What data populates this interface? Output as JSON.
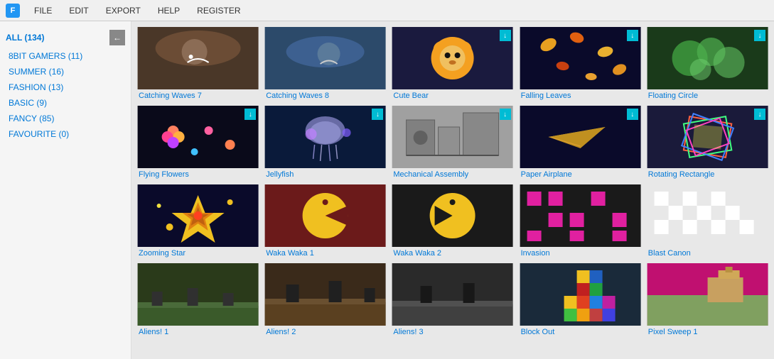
{
  "app": {
    "logo": "F",
    "menu": [
      "FILE",
      "EDIT",
      "EXPORT",
      "HELP",
      "REGISTER"
    ]
  },
  "sidebar": {
    "items": [
      {
        "label": "ALL (134)",
        "active": true
      },
      {
        "label": "8BIT GAMERS (11)",
        "active": false
      },
      {
        "label": "SUMMER (16)",
        "active": false
      },
      {
        "label": "FASHION (13)",
        "active": false
      },
      {
        "label": "BASIC (9)",
        "active": false
      },
      {
        "label": "FANCY (85)",
        "active": false
      },
      {
        "label": "FAVOURITE (0)",
        "active": false
      }
    ]
  },
  "gallery": {
    "items": [
      {
        "id": "catching7",
        "label": "Catching Waves 7",
        "has_download": false
      },
      {
        "id": "catching8",
        "label": "Catching Waves 8",
        "has_download": false
      },
      {
        "id": "cutebear",
        "label": "Cute Bear",
        "has_download": true
      },
      {
        "id": "fallingleaves",
        "label": "Falling Leaves",
        "has_download": true
      },
      {
        "id": "floatingcircle",
        "label": "Floating Circle",
        "has_download": true
      },
      {
        "id": "flyingflowers",
        "label": "Flying Flowers",
        "has_download": true
      },
      {
        "id": "jellyfish",
        "label": "Jellyfish",
        "has_download": true
      },
      {
        "id": "mechanical",
        "label": "Mechanical Assembly",
        "has_download": true
      },
      {
        "id": "paperairplane",
        "label": "Paper Airplane",
        "has_download": true
      },
      {
        "id": "rotatingrect",
        "label": "Rotating Rectangle",
        "has_download": true
      },
      {
        "id": "zoomingstar",
        "label": "Zooming Star",
        "has_download": false
      },
      {
        "id": "wakawaka1",
        "label": "Waka Waka 1",
        "has_download": false
      },
      {
        "id": "wakawaka2",
        "label": "Waka Waka 2",
        "has_download": false
      },
      {
        "id": "invasion",
        "label": "Invasion",
        "has_download": false
      },
      {
        "id": "blastcanon",
        "label": "Blast Canon",
        "has_download": false
      },
      {
        "id": "aliens1",
        "label": "Aliens! 1",
        "has_download": false
      },
      {
        "id": "aliens2",
        "label": "Aliens! 2",
        "has_download": false
      },
      {
        "id": "aliens3",
        "label": "Aliens! 3",
        "has_download": false
      },
      {
        "id": "blockout",
        "label": "Block Out",
        "has_download": false
      },
      {
        "id": "pixelsweep",
        "label": "Pixel Sweep 1",
        "has_download": false
      }
    ]
  }
}
